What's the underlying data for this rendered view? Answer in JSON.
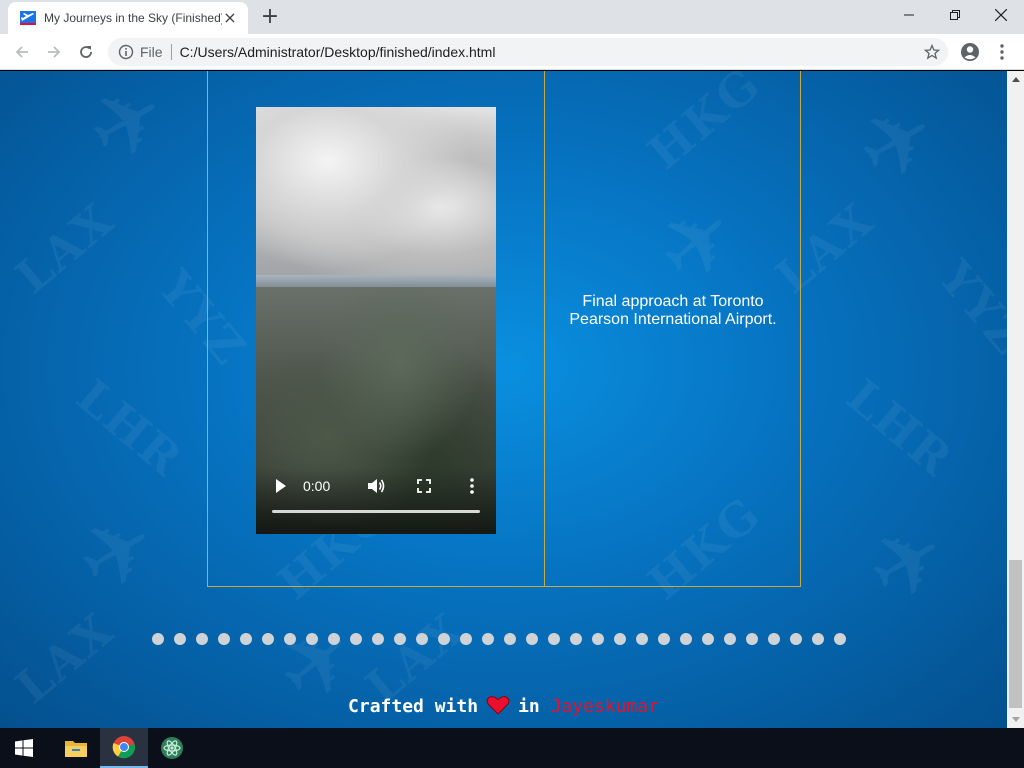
{
  "browser": {
    "tab_title": "My Journeys in the Sky (Finished)",
    "url_scheme": "File",
    "url": "C:/Users/Administrator/Desktop/finished/index.html"
  },
  "page": {
    "watermark_codes": [
      "LAX",
      "YYZ",
      "LHR",
      "HKG"
    ],
    "video": {
      "time": "0:00"
    },
    "caption": "Final approach at Toronto Pearson International Airport.",
    "carousel_dot_count": 32,
    "footer": {
      "prefix": "Crafted with",
      "middle": "in",
      "name": "Jayeskumar"
    }
  },
  "colors": {
    "page_background": "#0670bd",
    "table_border": "#c8a840",
    "footer_name": "#e8102c",
    "heart": "#e8102c"
  },
  "icons": {
    "tab_favicon": "plane-favicon-icon",
    "back": "back-arrow-icon",
    "forward": "forward-arrow-icon",
    "reload": "reload-icon",
    "info": "info-icon",
    "star": "star-icon",
    "profile": "account-icon",
    "menu": "kebab-menu-icon"
  }
}
